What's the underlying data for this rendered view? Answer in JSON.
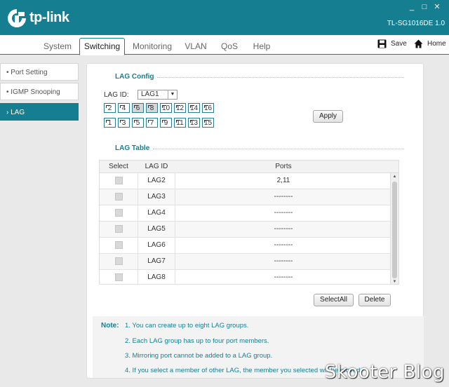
{
  "header": {
    "logo_text": "tp-link",
    "model": "TL-SG1016DE 1.0",
    "window_controls": [
      "_",
      "□",
      "✕"
    ]
  },
  "tabs": [
    "System",
    "Switching",
    "Monitoring",
    "VLAN",
    "QoS",
    "Help"
  ],
  "header_buttons": {
    "save": "Save",
    "home": "Home"
  },
  "sidebar": {
    "items": [
      {
        "label": "Port Setting"
      },
      {
        "label": "IGMP Snooping"
      },
      {
        "label": "LAG"
      }
    ]
  },
  "lag_config": {
    "title": "LAG Config",
    "lag_id_label": "LAG ID:",
    "lag_id_value": "LAG1",
    "ports_top": [
      "2",
      "4",
      "6",
      "8",
      "10",
      "12",
      "14",
      "16"
    ],
    "ports_bottom": [
      "1",
      "3",
      "5",
      "7",
      "9",
      "11",
      "13",
      "15"
    ],
    "selected_ports": [
      "6",
      "8"
    ],
    "apply_label": "Apply"
  },
  "lag_table": {
    "title": "LAG Table",
    "columns": [
      "Select",
      "LAG ID",
      "Ports"
    ],
    "rows": [
      {
        "id": "LAG2",
        "ports": "2,11"
      },
      {
        "id": "LAG3",
        "ports": "--------"
      },
      {
        "id": "LAG4",
        "ports": "--------"
      },
      {
        "id": "LAG5",
        "ports": "--------"
      },
      {
        "id": "LAG6",
        "ports": "--------"
      },
      {
        "id": "LAG7",
        "ports": "--------"
      },
      {
        "id": "LAG8",
        "ports": "--------"
      }
    ],
    "select_all_label": "SelectAll",
    "delete_label": "Delete"
  },
  "notes": {
    "title": "Note:",
    "items": [
      "1. You can create up to eight LAG groups.",
      "2. Each LAG group has up to four port members.",
      "3. Mirroring port cannot be added to a LAG group.",
      "4. If you select a member of other LAG, the member you selected will be moved"
    ]
  },
  "watermark": "Skooter Blog",
  "colors": {
    "accent": "#157f91",
    "panel": "#ffffff",
    "background": "#e9e9e9"
  }
}
